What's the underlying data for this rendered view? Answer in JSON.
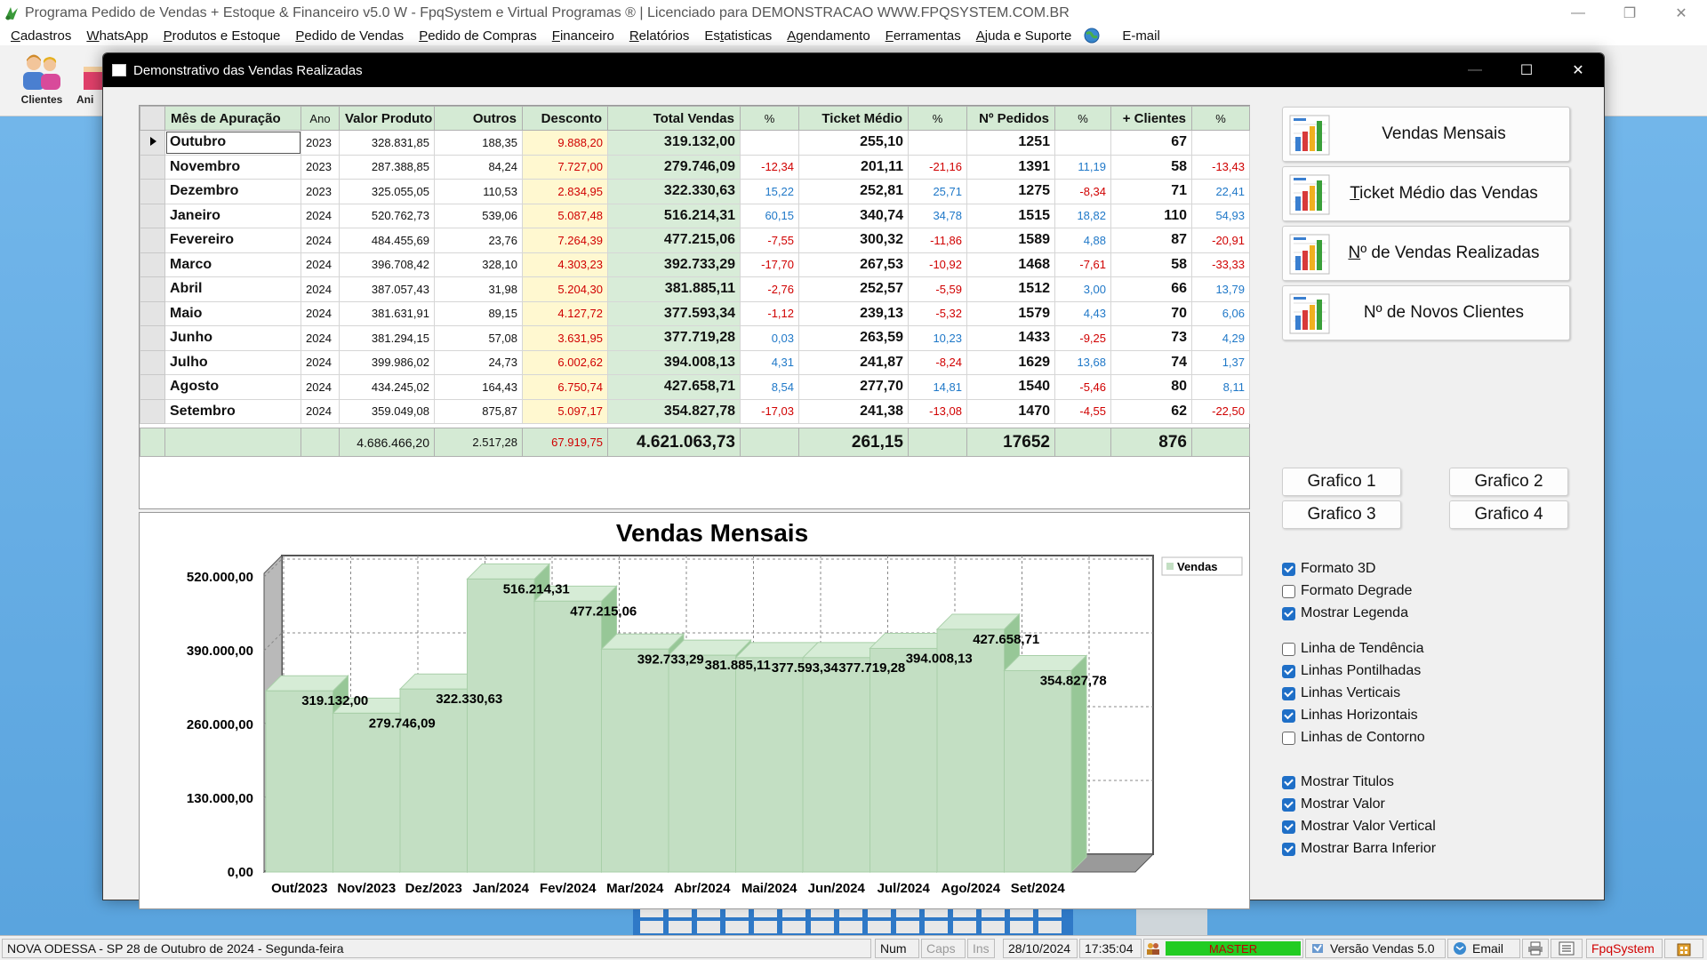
{
  "app": {
    "title": "Programa Pedido de Vendas + Estoque & Financeiro v5.0 W - FpqSystem e Virtual Programas ® | Licenciado para  DEMONSTRACAO WWW.FPQSYSTEM.COM.BR",
    "window_controls": [
      "—",
      "❐",
      "✕"
    ]
  },
  "menu": [
    {
      "pre": "",
      "u": "C",
      "post": "adastros"
    },
    {
      "pre": "",
      "u": "W",
      "post": "hatsApp"
    },
    {
      "pre": "",
      "u": "P",
      "post": "rodutos e Estoque"
    },
    {
      "pre": "",
      "u": "P",
      "post": "edido de Vendas"
    },
    {
      "pre": "",
      "u": "P",
      "post": "edido de Compras"
    },
    {
      "pre": "",
      "u": "F",
      "post": "inanceiro"
    },
    {
      "pre": "",
      "u": "R",
      "post": "elatórios"
    },
    {
      "pre": "Es",
      "u": "t",
      "post": "atisticas"
    },
    {
      "pre": "",
      "u": "A",
      "post": "gendamento"
    },
    {
      "pre": "",
      "u": "F",
      "post": "erramentas"
    },
    {
      "pre": "",
      "u": "A",
      "post": "juda e Suporte"
    }
  ],
  "menu_email": "E-mail",
  "toolbar": {
    "clientes": "Clientes",
    "second": "Ani"
  },
  "dialog": {
    "title": "Demonstrativo das Vendas Realizadas",
    "controls": [
      "—",
      "☐",
      "✕"
    ]
  },
  "grid": {
    "headers": [
      "Mês de Apuração",
      "Ano",
      "Valor Produto",
      "Outros",
      "Desconto",
      "Total Vendas",
      "%",
      "Ticket Médio",
      "%",
      "Nº Pedidos",
      "%",
      "+ Clientes",
      "%"
    ],
    "rows": [
      {
        "mes": "Outubro",
        "ano": "2023",
        "valor": "328.831,85",
        "outros": "188,35",
        "desconto": "9.888,20",
        "total": "319.132,00",
        "pct_total": "",
        "ticket": "255,10",
        "pct_ticket": "",
        "pedidos": "1251",
        "pct_pedidos": "",
        "clientes": "67",
        "pct_clientes": ""
      },
      {
        "mes": "Novembro",
        "ano": "2023",
        "valor": "287.388,85",
        "outros": "84,24",
        "desconto": "7.727,00",
        "total": "279.746,09",
        "pct_total": "-12,34",
        "ticket": "201,11",
        "pct_ticket": "-21,16",
        "pedidos": "1391",
        "pct_pedidos": "11,19",
        "clientes": "58",
        "pct_clientes": "-13,43"
      },
      {
        "mes": "Dezembro",
        "ano": "2023",
        "valor": "325.055,05",
        "outros": "110,53",
        "desconto": "2.834,95",
        "total": "322.330,63",
        "pct_total": "15,22",
        "ticket": "252,81",
        "pct_ticket": "25,71",
        "pedidos": "1275",
        "pct_pedidos": "-8,34",
        "clientes": "71",
        "pct_clientes": "22,41"
      },
      {
        "mes": "Janeiro",
        "ano": "2024",
        "valor": "520.762,73",
        "outros": "539,06",
        "desconto": "5.087,48",
        "total": "516.214,31",
        "pct_total": "60,15",
        "ticket": "340,74",
        "pct_ticket": "34,78",
        "pedidos": "1515",
        "pct_pedidos": "18,82",
        "clientes": "110",
        "pct_clientes": "54,93"
      },
      {
        "mes": "Fevereiro",
        "ano": "2024",
        "valor": "484.455,69",
        "outros": "23,76",
        "desconto": "7.264,39",
        "total": "477.215,06",
        "pct_total": "-7,55",
        "ticket": "300,32",
        "pct_ticket": "-11,86",
        "pedidos": "1589",
        "pct_pedidos": "4,88",
        "clientes": "87",
        "pct_clientes": "-20,91"
      },
      {
        "mes": "Marco",
        "ano": "2024",
        "valor": "396.708,42",
        "outros": "328,10",
        "desconto": "4.303,23",
        "total": "392.733,29",
        "pct_total": "-17,70",
        "ticket": "267,53",
        "pct_ticket": "-10,92",
        "pedidos": "1468",
        "pct_pedidos": "-7,61",
        "clientes": "58",
        "pct_clientes": "-33,33"
      },
      {
        "mes": "Abril",
        "ano": "2024",
        "valor": "387.057,43",
        "outros": "31,98",
        "desconto": "5.204,30",
        "total": "381.885,11",
        "pct_total": "-2,76",
        "ticket": "252,57",
        "pct_ticket": "-5,59",
        "pedidos": "1512",
        "pct_pedidos": "3,00",
        "clientes": "66",
        "pct_clientes": "13,79"
      },
      {
        "mes": "Maio",
        "ano": "2024",
        "valor": "381.631,91",
        "outros": "89,15",
        "desconto": "4.127,72",
        "total": "377.593,34",
        "pct_total": "-1,12",
        "ticket": "239,13",
        "pct_ticket": "-5,32",
        "pedidos": "1579",
        "pct_pedidos": "4,43",
        "clientes": "70",
        "pct_clientes": "6,06"
      },
      {
        "mes": "Junho",
        "ano": "2024",
        "valor": "381.294,15",
        "outros": "57,08",
        "desconto": "3.631,95",
        "total": "377.719,28",
        "pct_total": "0,03",
        "ticket": "263,59",
        "pct_ticket": "10,23",
        "pedidos": "1433",
        "pct_pedidos": "-9,25",
        "clientes": "73",
        "pct_clientes": "4,29"
      },
      {
        "mes": "Julho",
        "ano": "2024",
        "valor": "399.986,02",
        "outros": "24,73",
        "desconto": "6.002,62",
        "total": "394.008,13",
        "pct_total": "4,31",
        "ticket": "241,87",
        "pct_ticket": "-8,24",
        "pedidos": "1629",
        "pct_pedidos": "13,68",
        "clientes": "74",
        "pct_clientes": "1,37"
      },
      {
        "mes": "Agosto",
        "ano": "2024",
        "valor": "434.245,02",
        "outros": "164,43",
        "desconto": "6.750,74",
        "total": "427.658,71",
        "pct_total": "8,54",
        "ticket": "277,70",
        "pct_ticket": "14,81",
        "pedidos": "1540",
        "pct_pedidos": "-5,46",
        "clientes": "80",
        "pct_clientes": "8,11"
      },
      {
        "mes": "Setembro",
        "ano": "2024",
        "valor": "359.049,08",
        "outros": "875,87",
        "desconto": "5.097,17",
        "total": "354.827,78",
        "pct_total": "-17,03",
        "ticket": "241,38",
        "pct_ticket": "-13,08",
        "pedidos": "1470",
        "pct_pedidos": "-4,55",
        "clientes": "62",
        "pct_clientes": "-22,50"
      }
    ],
    "totals": {
      "valor": "4.686.466,20",
      "outros": "2.517,28",
      "desconto": "67.919,75",
      "total": "4.621.063,73",
      "ticket": "261,15",
      "pedidos": "17652",
      "clientes": "876"
    }
  },
  "chart_data": {
    "type": "bar",
    "title": "Vendas Mensais",
    "categories": [
      "Out/2023",
      "Nov/2023",
      "Dez/2023",
      "Jan/2024",
      "Fev/2024",
      "Mar/2024",
      "Abr/2024",
      "Mai/2024",
      "Jun/2024",
      "Jul/2024",
      "Ago/2024",
      "Set/2024"
    ],
    "series": [
      {
        "name": "Vendas",
        "values": [
          319132.0,
          279746.09,
          322330.63,
          516214.31,
          477215.06,
          392733.29,
          381885.11,
          377593.34,
          377719.28,
          394008.13,
          427658.71,
          354827.78
        ]
      }
    ],
    "value_labels": [
      "319.132,00",
      "279.746,09",
      "322.330,63",
      "516.214,31",
      "477.215,06",
      "392.733,29",
      "381.885,11",
      "377.593,34",
      "377.719,28",
      "394.008,13",
      "427.658,71",
      "354.827,78"
    ],
    "y_ticks": [
      0,
      130000,
      260000,
      390000,
      520000
    ],
    "y_tick_labels": [
      "0,00",
      "130.000,00",
      "260.000,00",
      "390.000,00",
      "520.000,00"
    ],
    "ylim": [
      0,
      520000
    ],
    "legend": "top-right",
    "style_3d": true,
    "grid": {
      "horizontal": true,
      "vertical": true,
      "dotted": true
    },
    "colors": {
      "bar": "#c3dfc3",
      "bar_side": "#97c797",
      "bar_top": "#d6ecd6",
      "floor": "#9a9a9a"
    }
  },
  "chart_buttons": [
    {
      "pre": "",
      "u": "",
      "post": "Vendas Mensais"
    },
    {
      "pre": "",
      "u": "T",
      "post": "icket Médio das Vendas"
    },
    {
      "pre": "",
      "u": "N",
      "post": "º de Vendas Realizadas"
    },
    {
      "pre": "",
      "u": "",
      "post": "Nº de Novos Clientes"
    }
  ],
  "grafico_buttons": [
    "Grafico 1",
    "Grafico 2",
    "Grafico 3",
    "Grafico 4"
  ],
  "options_group1": [
    {
      "label": "Formato 3D",
      "checked": true
    },
    {
      "label": "Formato Degrade",
      "checked": false
    },
    {
      "label": "Mostrar Legenda",
      "checked": true
    }
  ],
  "options_group2": [
    {
      "label": "Linha de Tendência",
      "checked": false
    },
    {
      "label": "Linhas Pontilhadas",
      "checked": true
    },
    {
      "label": "Linhas Verticais",
      "checked": true
    },
    {
      "label": "Linhas Horizontais",
      "checked": true
    },
    {
      "label": "Linhas de Contorno",
      "checked": false
    }
  ],
  "options_group3": [
    {
      "label": "Mostrar Titulos",
      "checked": true
    },
    {
      "label": "Mostrar Valor",
      "checked": true
    },
    {
      "label": "Mostrar Valor Vertical",
      "checked": true
    },
    {
      "label": "Mostrar Barra Inferior",
      "checked": true
    }
  ],
  "status": {
    "location": "NOVA ODESSA - SP 28 de Outubro de 2024 - Segunda-feira",
    "num": "Num",
    "caps": "Caps",
    "ins": "Ins",
    "date": "28/10/2024",
    "time": "17:35:04",
    "user": "MASTER",
    "version": "Versão Vendas 5.0",
    "email": "Email",
    "brand": "FpqSystem"
  },
  "colors": {
    "grid_header": "#d4ead4",
    "desconto_bg": "#fff8d0",
    "negative": "#d00000",
    "positive": "#1f78c8",
    "master_bg": "#22cc22",
    "brand": "#d00000"
  }
}
